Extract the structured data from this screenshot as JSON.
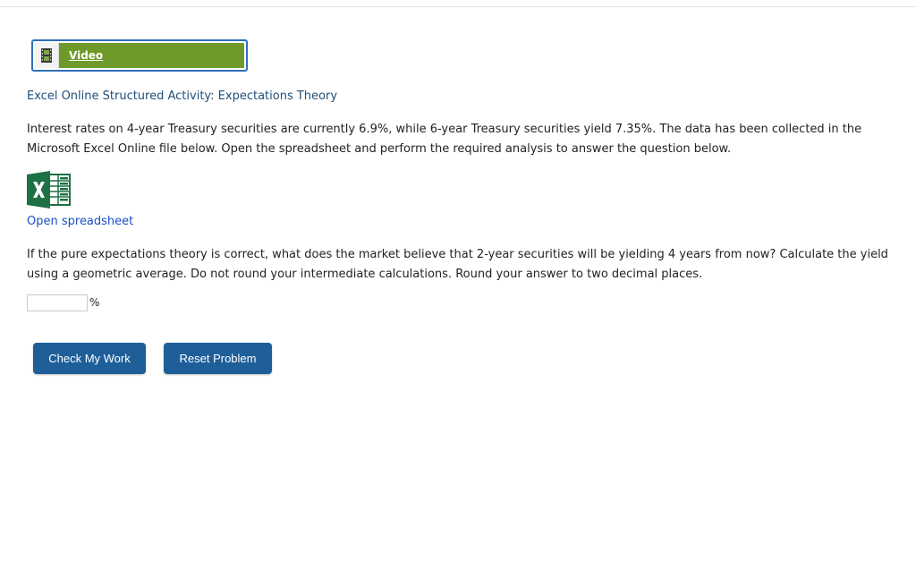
{
  "video": {
    "label": "Video",
    "icon": "film-icon",
    "accent_color": "#6e9a2a",
    "border_color": "#2f6fb8"
  },
  "activity": {
    "title": "Excel Online Structured Activity: Expectations Theory"
  },
  "intro": {
    "text": "Interest rates on 4-year Treasury securities are currently 6.9%, while 6-year Treasury securities yield 7.35%. The data has been collected in the Microsoft Excel Online file below. Open the spreadsheet and perform the required analysis to answer the question below."
  },
  "spreadsheet": {
    "icon": "excel-icon",
    "link_label": "Open spreadsheet",
    "icon_color": "#1e7145"
  },
  "question": {
    "text": "If the pure expectations theory is correct, what does the market believe that 2-year securities will be yielding 4 years from now? Calculate the yield using a geometric average. Do not round your intermediate calculations. Round your answer to two decimal places."
  },
  "answer": {
    "value": "",
    "unit": "%"
  },
  "buttons": {
    "check_label": "Check My Work",
    "reset_label": "Reset Problem",
    "color": "#1e5f9a"
  }
}
